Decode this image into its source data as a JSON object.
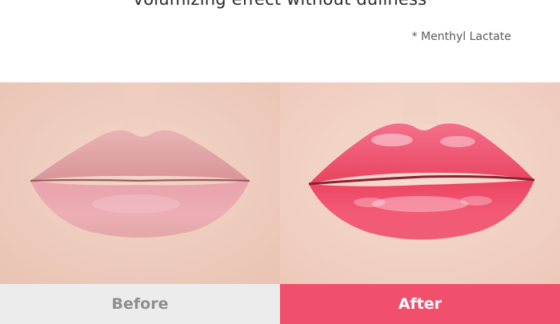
{
  "headline": "volumizing effect without dullness",
  "footnote": "* Menthyl Lactate",
  "panels": {
    "before": {
      "label": "Before",
      "bar_color": "#ececec",
      "label_color": "#8e8e8e",
      "lip_color": "#e6a7ad"
    },
    "after": {
      "label": "After",
      "bar_color": "#f24f6d",
      "label_color": "#ffffff",
      "lip_color": "#f2506e"
    }
  }
}
